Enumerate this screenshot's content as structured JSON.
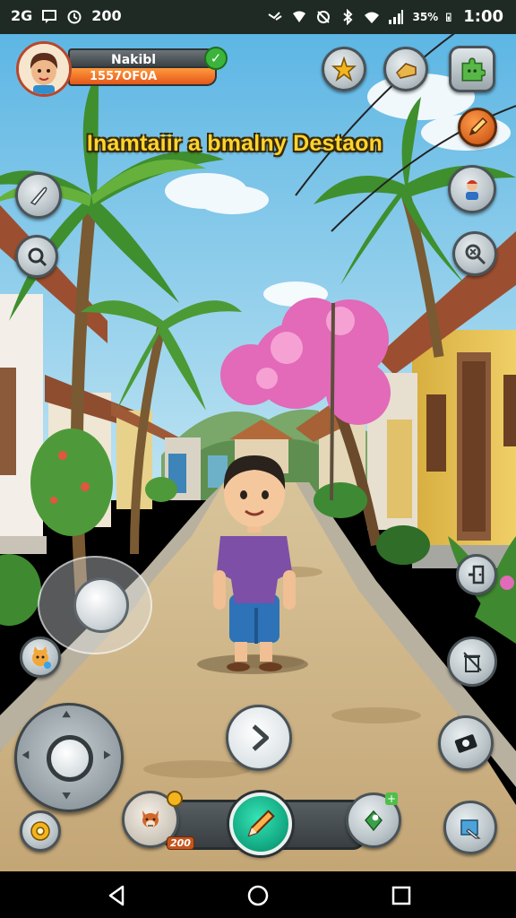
{
  "status_bar": {
    "left_items": [
      "2G",
      "200"
    ],
    "battery": "35%",
    "time": "1:00"
  },
  "player": {
    "name": "Nakibl",
    "score": "1557OF0A",
    "verified": true
  },
  "objective": {
    "text": "Inamtaiir a bmalny Destaon"
  },
  "hud": {
    "top_right_buttons": [
      "star-fruit-icon",
      "bread-icon",
      "puzzle-piece-icon"
    ],
    "right_column_buttons": [
      "pencil-icon",
      "character-icon",
      "inspect-icon",
      "door-icon",
      "trash-icon",
      "camera-icon",
      "map-icon"
    ],
    "left_column_buttons": [
      "knife-icon",
      "search-icon",
      "pet-icon",
      "settings-icon"
    ],
    "pet_badge_text": "200",
    "bottom_bar": {
      "left_item": "pet-fox-icon",
      "main_action": "pencil-icon",
      "right_item": "leaf-card-icon"
    }
  },
  "colors": {
    "objective_text": "#ffd42e",
    "score_plate": "#e4571a",
    "main_action": "#10a47e",
    "verified_badge": "#3cb43c"
  }
}
